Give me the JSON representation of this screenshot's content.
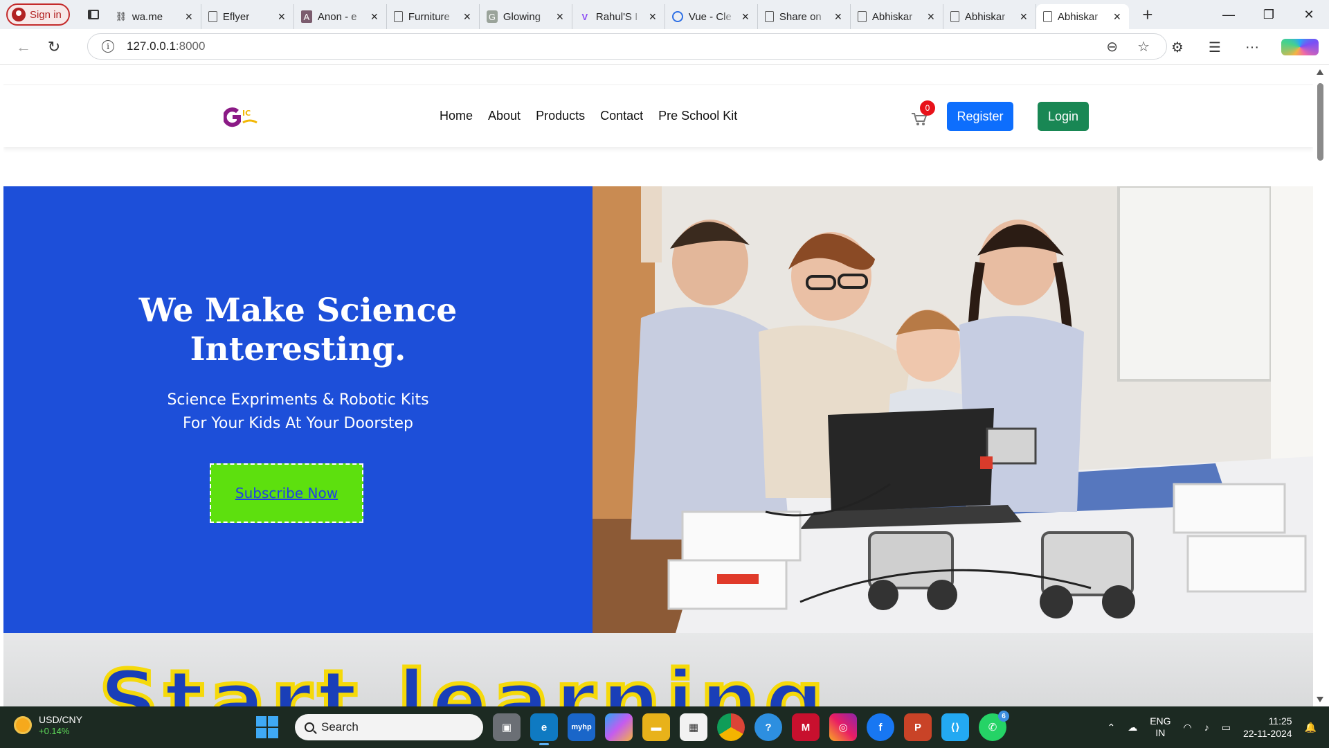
{
  "browser": {
    "signin_label": "Sign in",
    "tabs": [
      {
        "title": "wa.me",
        "icon": "broken-link-icon"
      },
      {
        "title": "Eflyer",
        "icon": "document-icon"
      },
      {
        "title": "Anon - e",
        "icon": "anon-logo-icon"
      },
      {
        "title": "Furniture",
        "icon": "document-icon"
      },
      {
        "title": "Glowing",
        "icon": "g-logo-icon"
      },
      {
        "title": "Rahul'S I",
        "icon": "vite-logo-icon"
      },
      {
        "title": "Vue - Cle",
        "icon": "vue-logo-icon"
      },
      {
        "title": "Share on",
        "icon": "document-icon"
      },
      {
        "title": "Abhiskar",
        "icon": "document-icon"
      },
      {
        "title": "Abhiskar",
        "icon": "document-icon"
      },
      {
        "title": "Abhiskar",
        "icon": "document-icon",
        "active": true
      }
    ],
    "address": {
      "host": "127.0.0.1",
      "port": ":8000"
    }
  },
  "site": {
    "nav": {
      "items": [
        "Home",
        "About",
        "Products",
        "Contact",
        "Pre School Kit"
      ],
      "cart_count": "0",
      "register_label": "Register",
      "login_label": "Login"
    },
    "hero": {
      "title_line1": "We Make Science",
      "title_line2": "Interesting.",
      "subtitle_line1": "Science Expriments & Robotic Kits",
      "subtitle_line2": "For Your Kids At Your Doorstep",
      "cta_label": "Subscribe Now",
      "bg_color": "#1d4fd9",
      "cta_color": "#5de00e"
    },
    "next_section_text": "Start learning"
  },
  "taskbar": {
    "ticker_pair": "USD/CNY",
    "ticker_change": "+0.14%",
    "search_placeholder": "Search",
    "whatsapp_badge": "6",
    "lang_top": "ENG",
    "lang_bottom": "IN",
    "time": "11:25",
    "date": "22-11-2024"
  },
  "colors": {
    "register": "#0d6efd",
    "login": "#198754",
    "badge": "#e8121a"
  }
}
